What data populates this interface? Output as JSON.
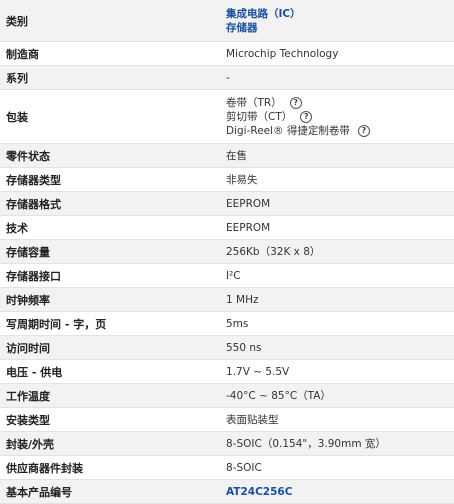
{
  "rows": [
    {
      "label": "类别",
      "values": [
        "集成电路（IC）",
        "存储器"
      ],
      "link": true
    },
    {
      "label": "制造商",
      "values": [
        "Microchip Technology"
      ]
    },
    {
      "label": "系列",
      "values": [
        "-"
      ]
    },
    {
      "label": "包装",
      "values": [
        "卷带（TR）",
        "剪切带（CT）",
        "Digi-Reel® 得捷定制卷带"
      ],
      "help": true
    },
    {
      "label": "零件状态",
      "values": [
        "在售"
      ]
    },
    {
      "label": "存储器类型",
      "values": [
        "非易失"
      ]
    },
    {
      "label": "存储器格式",
      "values": [
        "EEPROM"
      ]
    },
    {
      "label": "技术",
      "values": [
        "EEPROM"
      ]
    },
    {
      "label": "存储容量",
      "values": [
        "256Kb（32K x 8）"
      ]
    },
    {
      "label": "存储器接口",
      "values": [
        "I²C"
      ]
    },
    {
      "label": "时钟频率",
      "values": [
        "1 MHz"
      ]
    },
    {
      "label": "写周期时间 - 字，页",
      "values": [
        "5ms"
      ]
    },
    {
      "label": "访问时间",
      "values": [
        "550 ns"
      ]
    },
    {
      "label": "电压 - 供电",
      "values": [
        "1.7V ~ 5.5V"
      ]
    },
    {
      "label": "工作温度",
      "values": [
        "-40°C ~ 85°C（TA）"
      ]
    },
    {
      "label": "安装类型",
      "values": [
        "表面贴装型"
      ]
    },
    {
      "label": "封装/外壳",
      "values": [
        "8-SOIC（0.154\"，3.90mm 宽）"
      ]
    },
    {
      "label": "供应商器件封装",
      "values": [
        "8-SOIC"
      ]
    },
    {
      "label": "基本产品编号",
      "values": [
        "AT24C256C"
      ],
      "link": true
    }
  ],
  "help_icon": "question-circle-icon",
  "colors": {
    "link": "#1a4fa0",
    "shade": "#f2f2f2",
    "border": "#e2e2e2"
  }
}
